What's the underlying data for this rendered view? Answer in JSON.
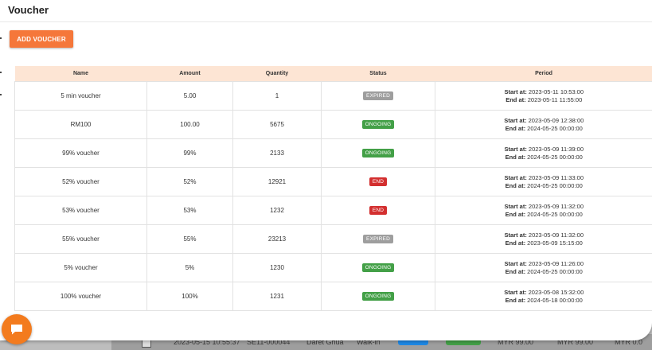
{
  "modal": {
    "title": "Voucher",
    "add_button": "ADD VOUCHER"
  },
  "table": {
    "headers": [
      "Name",
      "Amount",
      "Quantity",
      "Status",
      "Period"
    ],
    "period_start_label": "Start at:",
    "period_end_label": "End at:",
    "rows": [
      {
        "name": "5 min voucher",
        "amount": "5.00",
        "quantity": "1",
        "status": "EXPIRED",
        "start": "2023-05-11 10:53:00",
        "end": "2023-05-11 11:55:00"
      },
      {
        "name": "RM100",
        "amount": "100.00",
        "quantity": "5675",
        "status": "ONGOING",
        "start": "2023-05-09 12:38:00",
        "end": "2024-05-25 00:00:00"
      },
      {
        "name": "99% voucher",
        "amount": "99%",
        "quantity": "2133",
        "status": "ONGOING",
        "start": "2023-05-09 11:39:00",
        "end": "2024-05-25 00:00:00"
      },
      {
        "name": "52% voucher",
        "amount": "52%",
        "quantity": "12921",
        "status": "END",
        "start": "2023-05-09 11:33:00",
        "end": "2024-05-25 00:00:00"
      },
      {
        "name": "53% voucher",
        "amount": "53%",
        "quantity": "1232",
        "status": "END",
        "start": "2023-05-09 11:32:00",
        "end": "2024-05-25 00:00:00"
      },
      {
        "name": "55% voucher",
        "amount": "55%",
        "quantity": "23213",
        "status": "EXPIRED",
        "start": "2023-05-09 11:32:00",
        "end": "2023-05-09 15:15:00"
      },
      {
        "name": "5% voucher",
        "amount": "5%",
        "quantity": "1230",
        "status": "ONGOING",
        "start": "2023-05-09 11:26:00",
        "end": "2024-05-25 00:00:00"
      },
      {
        "name": "100% voucher",
        "amount": "100%",
        "quantity": "1231",
        "status": "ONGOING",
        "start": "2023-05-08 15:32:00",
        "end": "2024-05-18 00:00:00"
      }
    ]
  },
  "status_colors": {
    "EXPIRED": "#9e9e9e",
    "ONGOING": "#43a047",
    "END": "#d32f2f"
  },
  "background_row": {
    "date": "2023-05-15 10:55:37",
    "id": "SE11-000044",
    "name": "Daret Ghua",
    "type": "Walk-in",
    "a1": "MYR 99.00",
    "a2": "MYR 99.00",
    "a3": "MYR 0.0"
  },
  "chat": {
    "icon": "chat-icon"
  }
}
